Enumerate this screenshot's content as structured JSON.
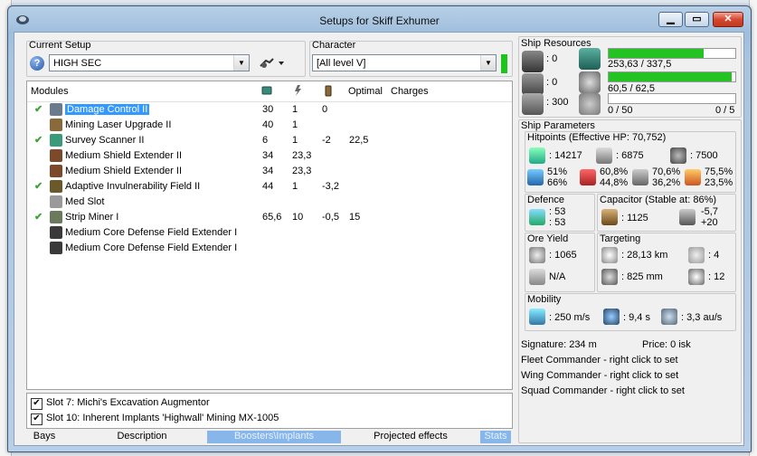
{
  "window": {
    "title": "Setups for Skiff Exhumer"
  },
  "setup": {
    "label": "Current Setup",
    "value": "HIGH SEC"
  },
  "character": {
    "label": "Character",
    "value": "[All level V]"
  },
  "modules": {
    "headers": {
      "modules": "Modules",
      "optimal": "Optimal",
      "charges": "Charges"
    },
    "rows": [
      {
        "active": true,
        "name": "Damage Control II",
        "cpu": "30",
        "pg": "1",
        "cap": "0",
        "optimal": "",
        "selected": true
      },
      {
        "active": false,
        "name": "Mining Laser Upgrade II",
        "cpu": "40",
        "pg": "1",
        "cap": "",
        "optimal": ""
      },
      {
        "active": true,
        "name": "Survey Scanner II",
        "cpu": "6",
        "pg": "1",
        "cap": "-2",
        "optimal": "22,5"
      },
      {
        "active": false,
        "name": "Medium Shield Extender II",
        "cpu": "34",
        "pg": "23,3",
        "cap": "",
        "optimal": ""
      },
      {
        "active": false,
        "name": "Medium Shield Extender II",
        "cpu": "34",
        "pg": "23,3",
        "cap": "",
        "optimal": ""
      },
      {
        "active": true,
        "name": "Adaptive Invulnerability Field II",
        "cpu": "44",
        "pg": "1",
        "cap": "-3,2",
        "optimal": ""
      },
      {
        "active": false,
        "name": "Med Slot",
        "cpu": "",
        "pg": "",
        "cap": "",
        "optimal": ""
      },
      {
        "active": true,
        "name": "Strip Miner I",
        "cpu": "65,6",
        "pg": "10",
        "cap": "-0,5",
        "optimal": "15"
      },
      {
        "active": false,
        "name": "Medium Core Defense Field Extender I",
        "cpu": "",
        "pg": "",
        "cap": "",
        "optimal": ""
      },
      {
        "active": false,
        "name": "Medium Core Defense Field Extender I",
        "cpu": "",
        "pg": "",
        "cap": "",
        "optimal": ""
      }
    ]
  },
  "implants": [
    {
      "checked": true,
      "label": "Slot 7: Michi's Excavation Augmentor"
    },
    {
      "checked": true,
      "label": "Slot 10: Inherent Implants 'Highwall' Mining MX-1005"
    }
  ],
  "tabs": [
    {
      "label": "Bays",
      "active": false
    },
    {
      "label": "Description",
      "active": false
    },
    {
      "label": "Boosters\\Implants",
      "active": true
    },
    {
      "label": "Projected effects",
      "active": false
    },
    {
      "label": "Stats",
      "active": true
    }
  ],
  "resources": {
    "title": "Ship Resources",
    "turret": ": 0",
    "launcher": ": 0",
    "drone_bw": ": 300",
    "cpu_text": "253,63 / 337,5",
    "cpu_fraction": 0.751,
    "pg_text": "60,5 / 62,5",
    "pg_fraction": 0.968,
    "drone_text": "0 / 50",
    "drone_count": "0 / 5"
  },
  "params": {
    "title": "Ship Parameters",
    "hp_label": "Hitpoints (Effective HP: 70,752)",
    "shield_hp": ": 14217",
    "armor_hp": ": 6875",
    "hull_hp": ": 7500",
    "res": {
      "em_top": "51%",
      "em_bottom": "66%",
      "th_top": "60,8%",
      "th_bottom": "44,8%",
      "ki_top": "70,6%",
      "ki_bottom": "36,2%",
      "ex_top": "75,5%",
      "ex_bottom": "23,5%"
    },
    "defence_label": "Defence",
    "defence_a": ": 53",
    "defence_b": ": 53",
    "cap_label": "Capacitor (Stable at: 86%)",
    "cap_amount": ": 1125",
    "cap_delta_a": "-5,7",
    "cap_delta_b": "+20",
    "ore_label": "Ore Yield",
    "ore_value": ": 1065",
    "ore_na": "N/A",
    "target_label": "Targeting",
    "target_range": ": 28,13 km",
    "target_max": ": 4",
    "target_res": ": 825 mm",
    "target_sensor": ": 12",
    "mobility_label": "Mobility",
    "speed": ": 250 m/s",
    "align": ": 9,4 s",
    "warp": ": 3,3 au/s",
    "signature": "Signature: 234 m",
    "price": "Price: 0 isk",
    "fleet": "Fleet Commander - right click to set",
    "wing": "Wing Commander - right click to set",
    "squad": "Squad Commander - right click to set"
  }
}
